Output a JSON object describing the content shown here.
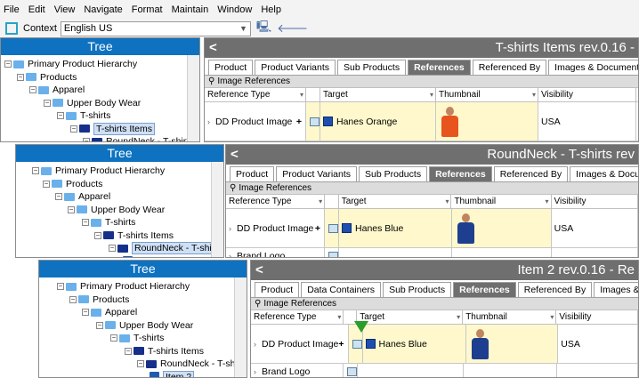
{
  "menu": [
    "File",
    "Edit",
    "View",
    "Navigate",
    "Format",
    "Maintain",
    "Window",
    "Help"
  ],
  "context": {
    "label": "Context",
    "value": "English US"
  },
  "panels": [
    {
      "tree_title": "Tree",
      "tree": [
        {
          "label": "Primary Product Hierarchy",
          "type": "folder"
        },
        {
          "label": "Products",
          "type": "folder"
        },
        {
          "label": "Apparel",
          "type": "folder"
        },
        {
          "label": "Upper Body Wear",
          "type": "folder"
        },
        {
          "label": "T-shirts",
          "type": "folder"
        },
        {
          "label": "T-shirts Items",
          "type": "dark",
          "selected": true
        },
        {
          "label": "RoundNeck - T-shirts",
          "type": "dark"
        }
      ],
      "title": "T-shirts Items rev.0.16 -",
      "tabs": [
        "Product",
        "Product Variants",
        "Sub Products",
        "References",
        "Referenced By",
        "Images & Documents"
      ],
      "active_tab": "References",
      "section": "Image References",
      "columns": [
        "Reference Type",
        "Target",
        "Thumbnail",
        "Visibility"
      ],
      "rows": [
        {
          "ref_type": "DD Product Image",
          "target": "Hanes Orange",
          "visibility": "USA",
          "shirt": "#e8541e"
        }
      ]
    },
    {
      "tree_title": "Tree",
      "tree": [
        {
          "label": "Primary Product Hierarchy",
          "type": "folder"
        },
        {
          "label": "Products",
          "type": "folder"
        },
        {
          "label": "Apparel",
          "type": "folder"
        },
        {
          "label": "Upper Body Wear",
          "type": "folder"
        },
        {
          "label": "T-shirts",
          "type": "folder"
        },
        {
          "label": "T-shirts Items",
          "type": "dark"
        },
        {
          "label": "RoundNeck - T-shirts",
          "type": "dark",
          "selected": true
        },
        {
          "label": "Item 2",
          "type": "item"
        }
      ],
      "title": "RoundNeck - T-shirts rev",
      "tabs": [
        "Product",
        "Product Variants",
        "Sub Products",
        "References",
        "Referenced By",
        "Images & Documents"
      ],
      "active_tab": "References",
      "section": "Image References",
      "columns": [
        "Reference Type",
        "Target",
        "Thumbnail",
        "Visibility"
      ],
      "rows": [
        {
          "ref_type": "DD Product Image",
          "target": "Hanes Blue",
          "visibility": "USA",
          "shirt": "#1e3f8f"
        },
        {
          "ref_type": "Brand Logo",
          "target": "",
          "visibility": ""
        }
      ]
    },
    {
      "tree_title": "Tree",
      "tree": [
        {
          "label": "Primary Product Hierarchy",
          "type": "folder"
        },
        {
          "label": "Products",
          "type": "folder"
        },
        {
          "label": "Apparel",
          "type": "folder"
        },
        {
          "label": "Upper Body Wear",
          "type": "folder"
        },
        {
          "label": "T-shirts",
          "type": "folder"
        },
        {
          "label": "T-shirts Items",
          "type": "dark"
        },
        {
          "label": "RoundNeck - T-shirts",
          "type": "dark"
        },
        {
          "label": "Item 2",
          "type": "item",
          "selected": true
        }
      ],
      "title": "Item 2 rev.0.16 - Re",
      "tabs": [
        "Product",
        "Data Containers",
        "Sub Products",
        "References",
        "Referenced By",
        "Images & Documents"
      ],
      "active_tab": "References",
      "section": "Image References",
      "columns": [
        "Reference Type",
        "Target",
        "Thumbnail",
        "Visibility"
      ],
      "rows": [
        {
          "ref_type": "DD Product Image",
          "target": "Hanes Blue",
          "visibility": "USA",
          "shirt": "#1e3f8f",
          "inherited": true
        },
        {
          "ref_type": "Brand Logo",
          "target": "",
          "visibility": ""
        }
      ]
    }
  ],
  "colors": {
    "tree_header": "#0e72c0",
    "detail_header": "#6f6f6f",
    "highlight": "#fef8cc",
    "inherit_marker": "#2a9d2a"
  }
}
